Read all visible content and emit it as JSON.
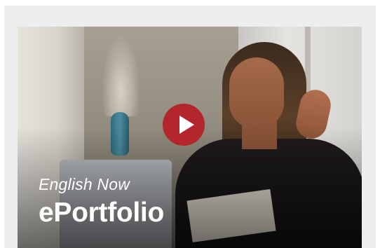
{
  "video": {
    "subtitle": "English Now",
    "title": "ePortfolio",
    "play_icon": "play-icon",
    "play_color": "#b3262b"
  }
}
